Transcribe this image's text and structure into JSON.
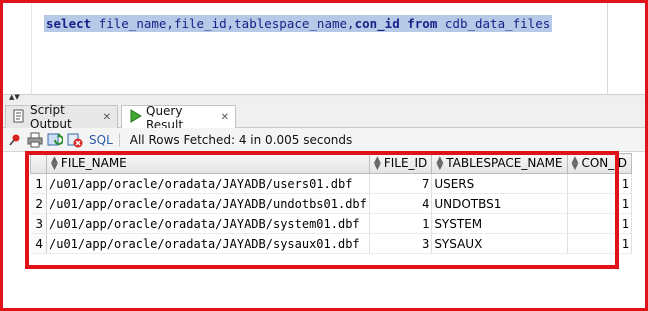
{
  "editor": {
    "sql": {
      "kw_select": "select",
      "cols": "file_name,file_id,tablespace_name,",
      "con_id": "con_id",
      "kw_from": "from",
      "table": "cdb_data_files"
    }
  },
  "tabs": [
    {
      "label": "Script Output",
      "icon": "script-output-icon"
    },
    {
      "label": "Query Result",
      "icon": "run-query-icon"
    }
  ],
  "toolbar": {
    "icons": [
      "pin-icon",
      "print-icon",
      "refresh-icon",
      "cancel-query-icon"
    ],
    "sql_label": "SQL",
    "status": "All Rows Fetched: 4 in 0.005 seconds"
  },
  "grid": {
    "columns": [
      "FILE_NAME",
      "FILE_ID",
      "TABLESPACE_NAME",
      "CON_ID"
    ],
    "rows": [
      {
        "n": "1",
        "file_name": "/u01/app/oracle/oradata/JAYADB/users01.dbf",
        "file_id": "7",
        "tablespace_name": "USERS",
        "con_id": "1"
      },
      {
        "n": "2",
        "file_name": "/u01/app/oracle/oradata/JAYADB/undotbs01.dbf",
        "file_id": "4",
        "tablespace_name": "UNDOTBS1",
        "con_id": "1"
      },
      {
        "n": "3",
        "file_name": "/u01/app/oracle/oradata/JAYADB/system01.dbf",
        "file_id": "1",
        "tablespace_name": "SYSTEM",
        "con_id": "1"
      },
      {
        "n": "4",
        "file_name": "/u01/app/oracle/oradata/JAYADB/sysaux01.dbf",
        "file_id": "3",
        "tablespace_name": "SYSAUX",
        "con_id": "1"
      }
    ]
  },
  "colors": {
    "highlight": "#e0131b",
    "selection": "#b6c9e6",
    "keyword": "#1a1f8a"
  }
}
